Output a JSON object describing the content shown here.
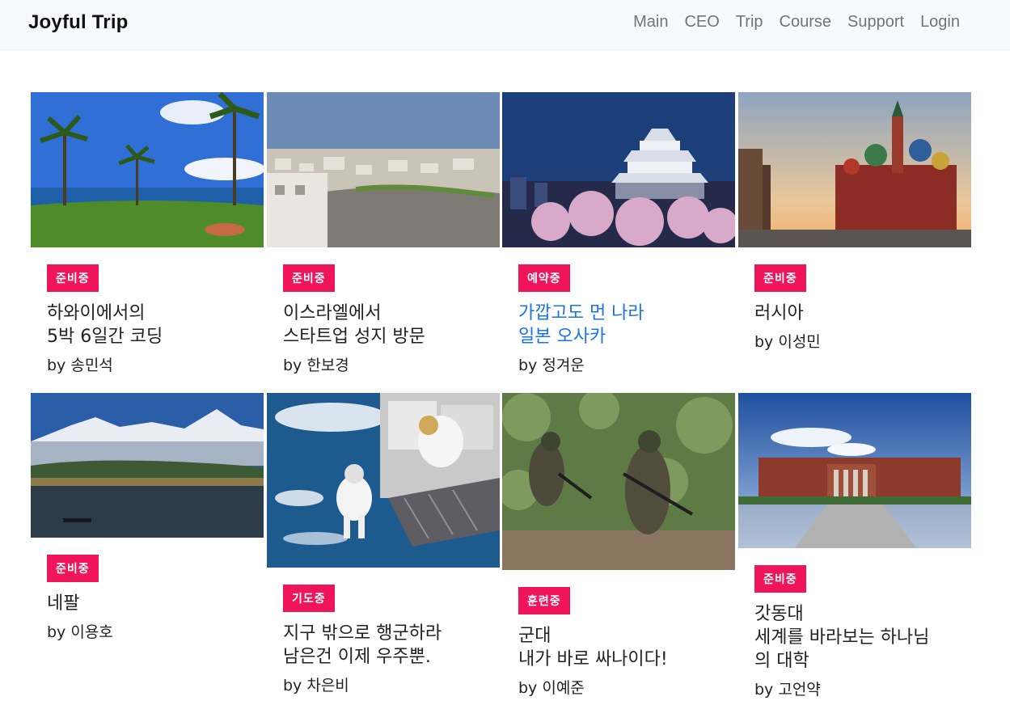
{
  "brand": "Joyful Trip",
  "nav": [
    "Main",
    "CEO",
    "Trip",
    "Course",
    "Support",
    "Login"
  ],
  "cards": [
    {
      "badge": "준비중",
      "title": "하와이에서의\n5박 6일간 코딩",
      "author": "by 송민석",
      "image": "hawaii-beach-palms"
    },
    {
      "badge": "준비중",
      "title": "이스라엘에서\n스타트업 성지 방문",
      "author": "by 한보경",
      "image": "israel-city-view"
    },
    {
      "badge": "예약중",
      "title": "가깝고도 먼 나라\n일본 오사카",
      "author": "by 정겨운",
      "image": "osaka-castle-night",
      "highlight": true
    },
    {
      "badge": "준비중",
      "title": "러시아",
      "author": "by 이성민",
      "image": "moscow-cathedral"
    },
    {
      "badge": "준비중",
      "title": "네팔",
      "author": "by 이용호",
      "image": "nepal-mountain-lake"
    },
    {
      "badge": "기도중",
      "title": "지구 밖으로 행군하라\n남은건 이제 우주뿐.",
      "author": "by 차은비",
      "image": "astronaut-space-station"
    },
    {
      "badge": "훈련중",
      "title": "군대\n내가 바로 싸나이다!",
      "author": "by 이예준",
      "image": "soldiers-training"
    },
    {
      "badge": "준비중",
      "title": "갓동대\n세계를 바라보는 하나님\n의 대학",
      "author": "by 고언약",
      "image": "university-building"
    }
  ]
}
